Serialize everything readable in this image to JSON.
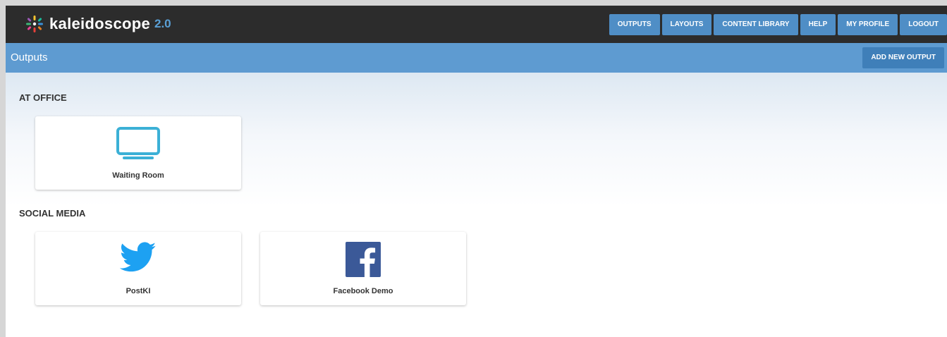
{
  "app": {
    "name": "kaleidoscope",
    "version": "2.0"
  },
  "nav": {
    "items": [
      "OUTPUTS",
      "LAYOUTS",
      "CONTENT LIBRARY",
      "HELP",
      "MY PROFILE",
      "LOGOUT"
    ]
  },
  "page": {
    "title": "Outputs",
    "add_button": "ADD NEW OUTPUT"
  },
  "sections": [
    {
      "title": "AT OFFICE",
      "cards": [
        {
          "label": "Waiting Room",
          "icon": "monitor-icon"
        }
      ]
    },
    {
      "title": "SOCIAL MEDIA",
      "cards": [
        {
          "label": "PostKI",
          "icon": "twitter-icon"
        },
        {
          "label": "Facebook Demo",
          "icon": "facebook-icon"
        }
      ]
    }
  ],
  "colors": {
    "topbar": "#2c2c2c",
    "nav_button": "#4f8ec6",
    "subbar": "#5e9bd1",
    "monitor": "#3bb0d6",
    "twitter": "#1da1f2",
    "facebook": "#3b5998"
  }
}
